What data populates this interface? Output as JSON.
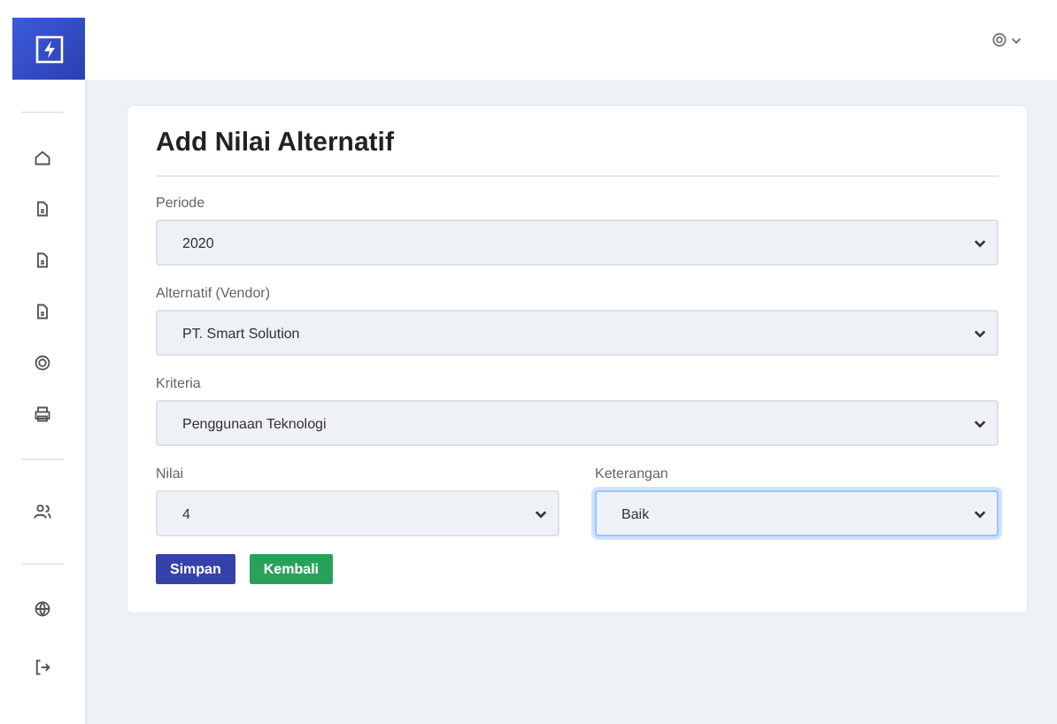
{
  "form": {
    "title": "Add Nilai Alternatif",
    "rows": [
      [
        {
          "label": "Periode",
          "value": "2020",
          "focused": false
        }
      ],
      [
        {
          "label": "Alternatif (Vendor)",
          "value": "PT. Smart Solution",
          "focused": false
        }
      ],
      [
        {
          "label": "Kriteria",
          "value": "Penggunaan Teknologi",
          "focused": false
        }
      ],
      [
        {
          "label": "Nilai",
          "value": "4",
          "focused": false
        },
        {
          "label": "Keterangan",
          "value": "Baik",
          "focused": true
        }
      ]
    ],
    "buttons": [
      {
        "label": "Simpan",
        "kind": "primary"
      },
      {
        "label": "Kembali",
        "kind": "success"
      }
    ]
  }
}
